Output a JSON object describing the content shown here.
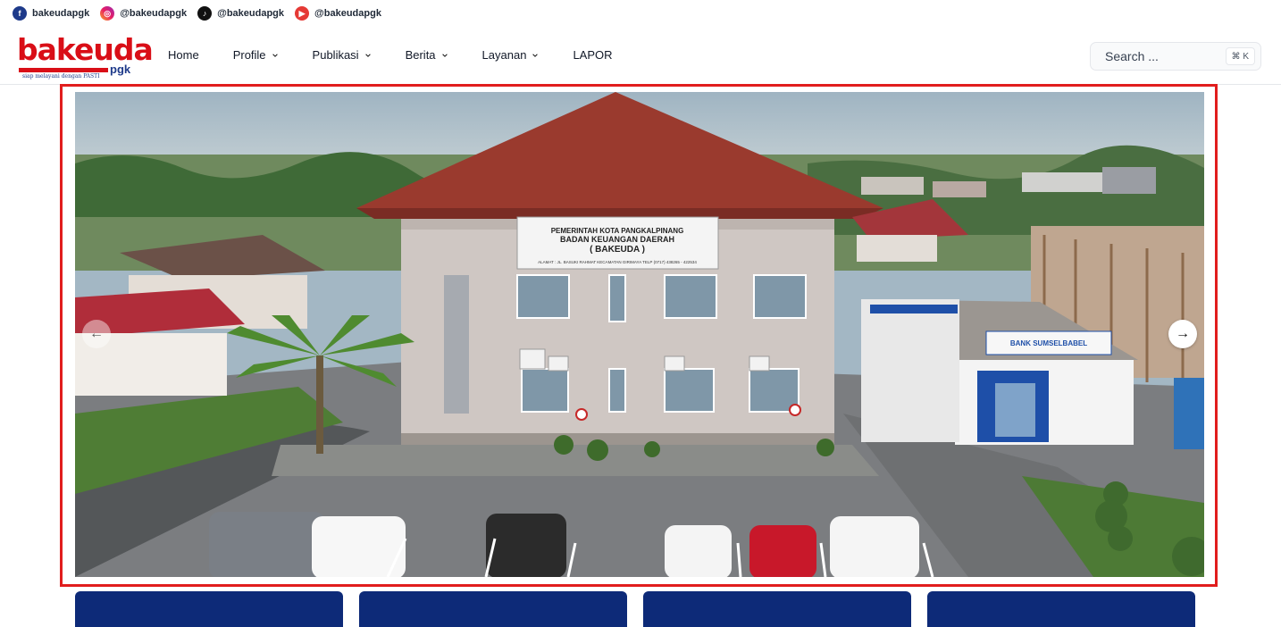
{
  "social": [
    {
      "icon": "facebook-icon",
      "glyph": "f",
      "handle": "bakeudapgk"
    },
    {
      "icon": "instagram-icon",
      "glyph": "◎",
      "handle": "@bakeudapgk"
    },
    {
      "icon": "tiktok-icon",
      "glyph": "♪",
      "handle": "@bakeudapgk"
    },
    {
      "icon": "youtube-icon",
      "glyph": "▶",
      "handle": "@bakeudapgk"
    }
  ],
  "logo": {
    "word": "bakeuda",
    "suffix": "pgk",
    "tagline": "siap melayani dengan PASTI",
    "color": "#d90e17"
  },
  "nav": {
    "home": "Home",
    "profile": "Profile",
    "publikasi": "Publikasi",
    "berita": "Berita",
    "layanan": "Layanan",
    "lapor": "LAPOR"
  },
  "search": {
    "placeholder": "Search ...",
    "shortcut": "⌘ K"
  },
  "carousel": {
    "prev_icon": "arrow-left-icon",
    "next_icon": "arrow-right-icon",
    "prev_glyph": "←",
    "next_glyph": "→",
    "sign_line1": "PEMERINTAH KOTA PANGKALPINANG",
    "sign_line2": "BADAN KEUANGAN DAERAH",
    "sign_line3": "( BAKEUDA )",
    "sign_line4": "ALAMAT : JL. BASUKI RAHMAT KECAMATAN GIRIMAYA  TELP (0717) 438265 - 422534",
    "bank_sign": "BANK SUMSELBABEL"
  },
  "colors": {
    "accent": "#e11d1d",
    "brand_blue": "#0d2a78"
  }
}
